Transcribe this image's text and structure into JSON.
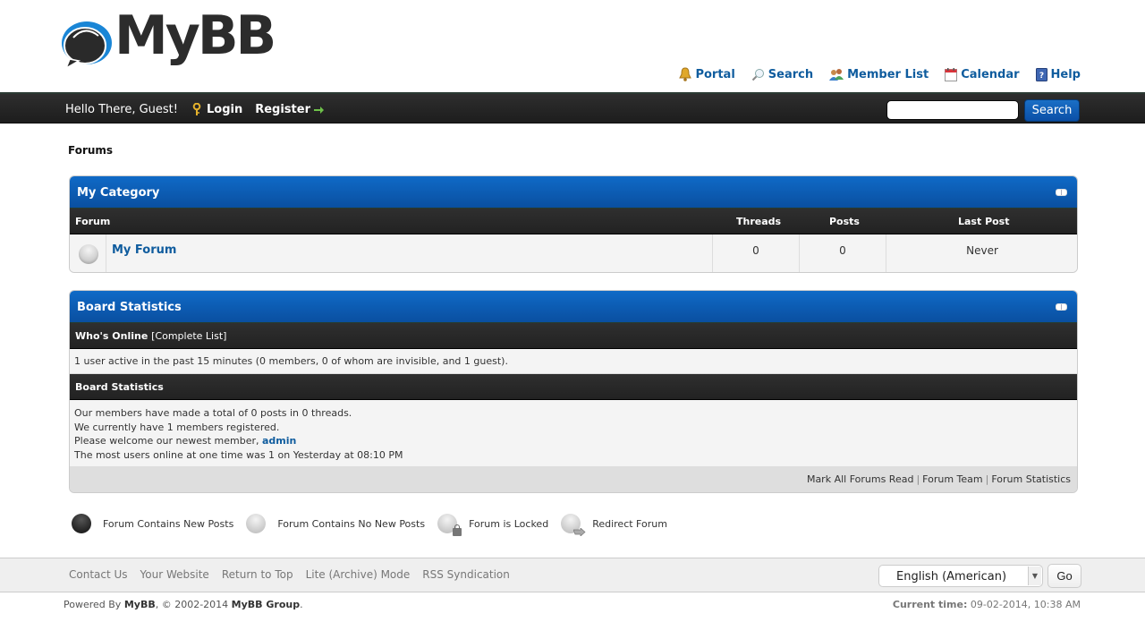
{
  "header": {
    "logo_text": "MyBB",
    "top_links": [
      {
        "label": "Portal",
        "icon": "bell-icon"
      },
      {
        "label": "Search",
        "icon": "magnifier-icon"
      },
      {
        "label": "Member List",
        "icon": "members-icon"
      },
      {
        "label": "Calendar",
        "icon": "calendar-icon"
      },
      {
        "label": "Help",
        "icon": "help-book-icon"
      }
    ]
  },
  "panel": {
    "greeting": "Hello There, Guest!",
    "login_label": "Login",
    "register_label": "Register",
    "search_value": "",
    "search_button": "Search"
  },
  "breadcrumb": "Forums",
  "category": {
    "title": "My Category",
    "columns": {
      "forum": "Forum",
      "threads": "Threads",
      "posts": "Posts",
      "lastpost": "Last Post"
    },
    "forums": [
      {
        "name": "My Forum",
        "threads": "0",
        "posts": "0",
        "lastpost": "Never",
        "status": "no-new-posts"
      }
    ]
  },
  "stats": {
    "title": "Board Statistics",
    "whos_online_label": "Who's Online",
    "complete_list_label": "[Complete List]",
    "online_text": "1 user active in the past 15 minutes (0 members, 0 of whom are invisible, and 1 guest).",
    "board_stats_label": "Board Statistics",
    "line1": "Our members have made a total of 0 posts in 0 threads.",
    "line2": "We currently have 1 members registered.",
    "line3_prefix": "Please welcome our newest member, ",
    "newest_member": "admin",
    "line4": "The most users online at one time was 1 on Yesterday at 08:10 PM",
    "footer_links": [
      "Mark All Forums Read",
      "Forum Team",
      "Forum Statistics"
    ]
  },
  "legend": [
    {
      "label": "Forum Contains New Posts"
    },
    {
      "label": "Forum Contains No New Posts"
    },
    {
      "label": "Forum is Locked"
    },
    {
      "label": "Redirect Forum"
    }
  ],
  "footer": {
    "links": [
      "Contact Us",
      "Your Website",
      "Return to Top",
      "Lite (Archive) Mode",
      "RSS Syndication"
    ],
    "language": "English (American)",
    "go_label": "Go",
    "powered_by": "Powered By ",
    "mybb": "MyBB",
    "copyright_mid": ", © 2002-2014 ",
    "mybb_group": "MyBB Group",
    "period": ".",
    "current_time_label": "Current time:",
    "current_time_value": " 09-02-2014, 10:38 AM"
  },
  "colors": {
    "accent_blue": "#0f5c9e",
    "header_blue": "#0b5bb5",
    "panel_dark": "#262626"
  }
}
